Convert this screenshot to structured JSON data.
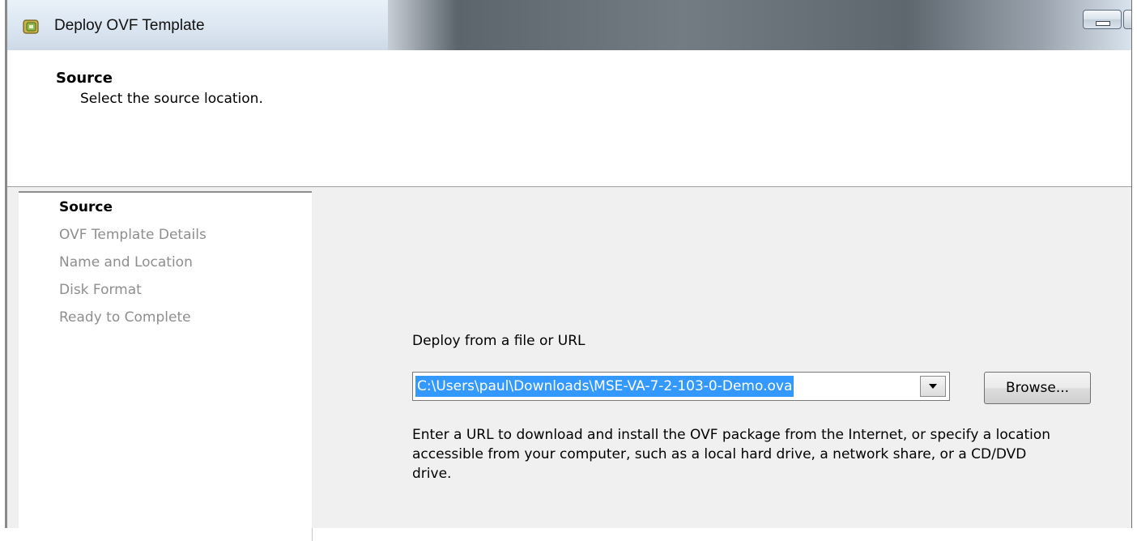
{
  "window": {
    "title": "Deploy OVF Template",
    "icon": "ovf-package-icon"
  },
  "header": {
    "title": "Source",
    "subtitle": "Select the source location."
  },
  "steps": [
    {
      "label": "Source",
      "active": true
    },
    {
      "label": "OVF Template Details",
      "active": false
    },
    {
      "label": "Name and Location",
      "active": false
    },
    {
      "label": "Disk Format",
      "active": false
    },
    {
      "label": "Ready to Complete",
      "active": false
    }
  ],
  "main": {
    "deploy_label": "Deploy from a file or URL",
    "source_value": "C:\\Users\\paul\\Downloads\\MSE-VA-7-2-103-0-Demo.ova",
    "browse_label": "Browse...",
    "help_text": "Enter a URL to download and install the OVF package from the Internet, or specify a location accessible from your computer, such as a local hard drive, a network share, or a CD/DVD drive."
  },
  "colors": {
    "selection": "#3399ff",
    "inactive_step": "#8e8e8e"
  }
}
